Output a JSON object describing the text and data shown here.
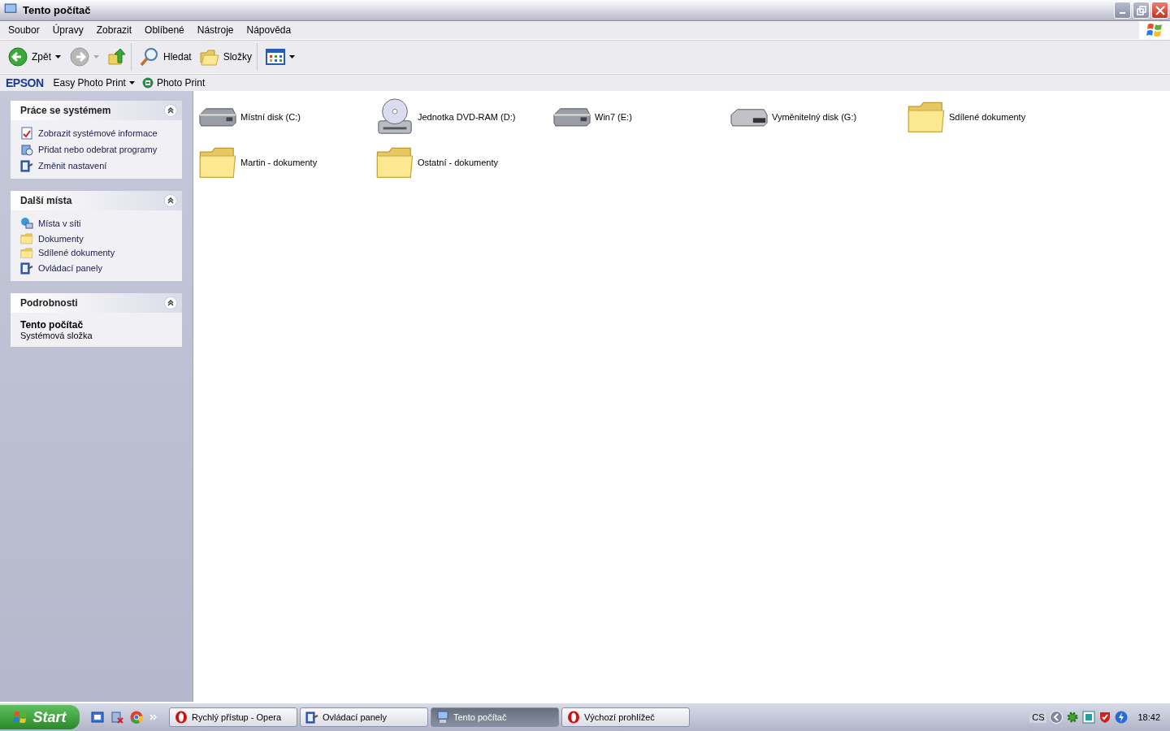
{
  "window": {
    "title": "Tento počítač"
  },
  "menu": [
    "Soubor",
    "Úpravy",
    "Zobrazit",
    "Oblíbené",
    "Nástroje",
    "Nápověda"
  ],
  "toolbar": [
    {
      "kind": "back",
      "label": "Zpět",
      "disabled": false
    },
    {
      "kind": "forward",
      "disabled": true
    },
    {
      "kind": "up"
    },
    {
      "kind": "search",
      "label": "Hledat"
    },
    {
      "kind": "folders",
      "label": "Složky"
    },
    {
      "kind": "views"
    }
  ],
  "epson_bar": {
    "logo": "EPSON",
    "menu": "Easy Photo Print",
    "button": "Photo Print"
  },
  "sidebar": [
    {
      "title": "Práce se systémem",
      "expanded": true,
      "items": [
        {
          "kind": "sysinfo",
          "label": "Zobrazit systémové informace"
        },
        {
          "kind": "programs",
          "label": "Přidat nebo odebrat programy"
        },
        {
          "kind": "control",
          "label": "Změnit nastavení"
        }
      ]
    },
    {
      "title": "Další místa",
      "expanded": true,
      "items": [
        {
          "kind": "network",
          "label": "Místa v síti"
        },
        {
          "kind": "documents",
          "label": "Dokumenty"
        },
        {
          "kind": "folder",
          "label": "Sdílené dokumenty"
        },
        {
          "kind": "control",
          "label": "Ovládací panely"
        }
      ]
    },
    {
      "title": "Podrobnosti",
      "expanded": true,
      "details": {
        "name": "Tento počítač",
        "description": "Systémová složka"
      }
    }
  ],
  "items": [
    {
      "kind": "hdd",
      "label": "Místní disk (C:)"
    },
    {
      "kind": "dvd",
      "label": "Jednotka DVD-RAM (D:)"
    },
    {
      "kind": "hdd",
      "label": "Win7 (E:)"
    },
    {
      "kind": "removable",
      "label": "Vyměnitelný disk (G:)"
    },
    {
      "kind": "folder",
      "label": "Sdílené dokumenty"
    },
    {
      "kind": "folder",
      "label": "Martin - dokumenty"
    },
    {
      "kind": "folder",
      "label": "Ostatní - dokumenty"
    }
  ],
  "taskbar": {
    "start": "Start",
    "tasks": [
      {
        "kind": "opera",
        "label": "Rychlý přístup - Opera",
        "selected": false
      },
      {
        "kind": "control",
        "label": "Ovládací panely",
        "selected": false
      },
      {
        "kind": "computer",
        "label": "Tento počítač",
        "selected": true
      },
      {
        "kind": "opera",
        "label": "Výchozí prohlížeč",
        "selected": false
      }
    ],
    "language": "CS",
    "clock": "18:42"
  }
}
